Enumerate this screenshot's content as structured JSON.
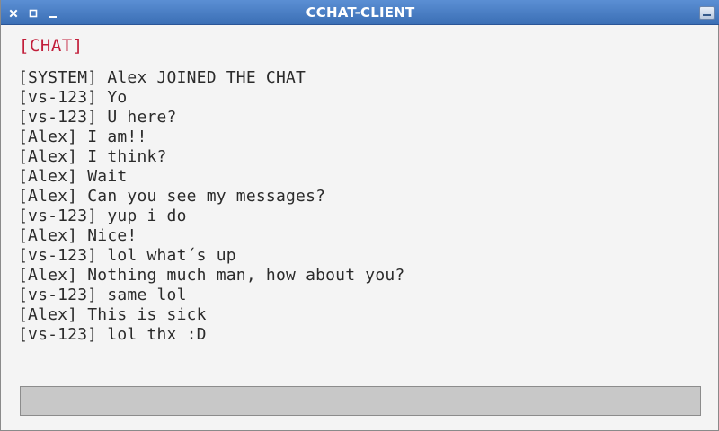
{
  "window": {
    "title": "CCHAT-CLIENT",
    "controls": [
      "close-icon",
      "maximize-icon",
      "minimize-icon",
      "window-menu-icon"
    ]
  },
  "chat": {
    "heading": "[CHAT]",
    "heading_color": "#c21e3a",
    "messages": [
      "[SYSTEM] Alex JOINED THE CHAT",
      "[vs-123] Yo",
      "[vs-123] U here?",
      "[Alex] I am!!",
      "[Alex] I think?",
      "[Alex] Wait",
      "[Alex] Can you see my messages?",
      "[vs-123] yup i do",
      "[Alex] Nice!",
      "[vs-123] lol what´s up",
      "[Alex] Nothing much man, how about you?",
      "[vs-123] same lol",
      "[Alex] This is sick",
      "[vs-123] lol thx :D"
    ]
  },
  "input": {
    "value": "",
    "placeholder": ""
  },
  "colors": {
    "titlebar": "#3b6fb5",
    "background": "#f4f4f4",
    "input_background": "#c8c8c8"
  }
}
